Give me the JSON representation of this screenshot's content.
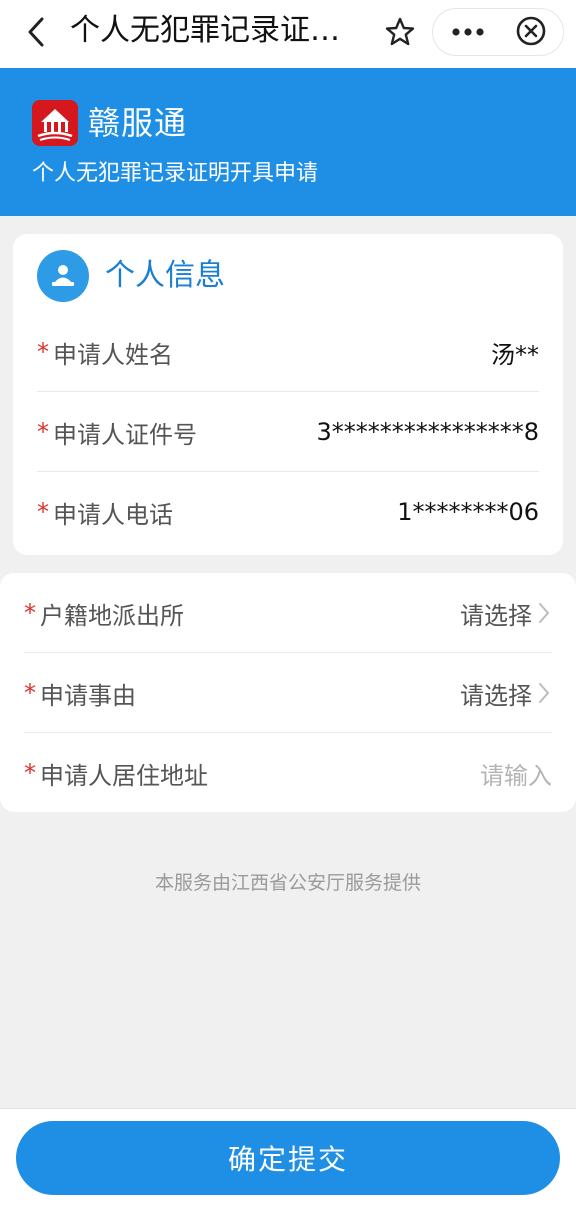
{
  "nav": {
    "title": "个人无犯罪记录证…",
    "back_icon": "chevron-left-icon",
    "star_icon": "star-icon",
    "more_icon": "more-dots-icon",
    "close_icon": "close-circle-icon"
  },
  "banner": {
    "brand": "赣服通",
    "subtitle": "个人无犯罪记录证明开具申请",
    "color": "#1f8fe5",
    "logo_color": "#d4181d"
  },
  "personal_info": {
    "title": "个人信息",
    "icon": "person-id-icon",
    "rows": [
      {
        "required": "*",
        "label": "申请人姓名",
        "value": "汤**"
      },
      {
        "required": "*",
        "label": "申请人证件号",
        "value": "3****************8"
      },
      {
        "required": "*",
        "label": "申请人电话",
        "value": "1********06"
      }
    ]
  },
  "application": {
    "rows": [
      {
        "required": "*",
        "label": "户籍地派出所",
        "value": "请选择"
      },
      {
        "required": "*",
        "label": "申请事由",
        "value": "请选择"
      },
      {
        "required": "*",
        "label": "申请人居住地址",
        "placeholder": "请输入"
      }
    ]
  },
  "footer": {
    "note": "本服务由江西省公安厅服务提供"
  },
  "submit": {
    "label": "确定提交",
    "color": "#1f8fe5"
  }
}
